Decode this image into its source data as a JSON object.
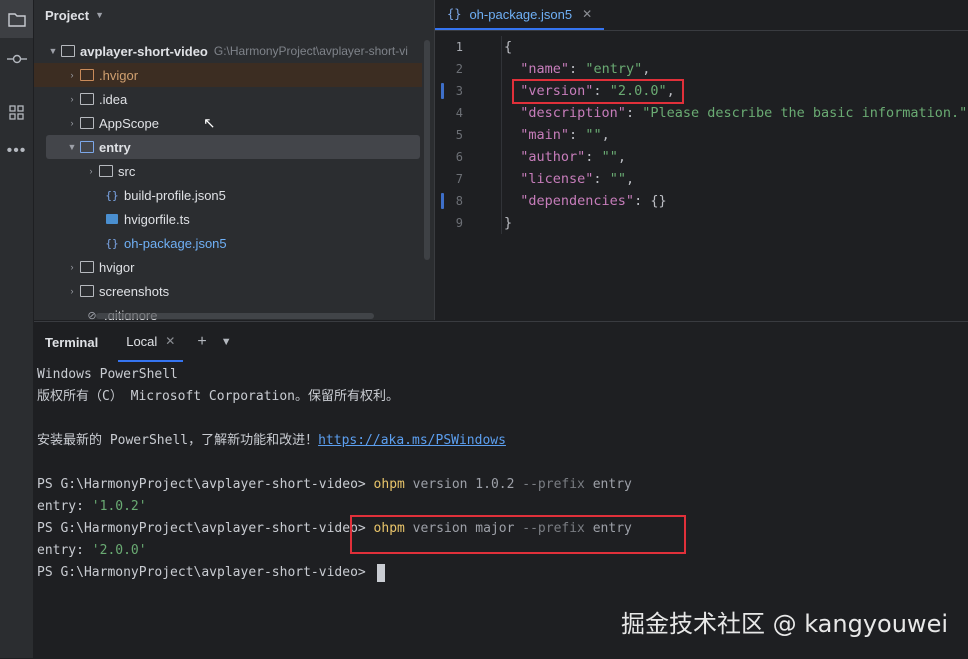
{
  "sidebar_tools": [
    "folder-icon",
    "commit-icon",
    "structure-icon",
    "more-icon"
  ],
  "project": {
    "title": "Project",
    "root": {
      "name": "avplayer-short-video",
      "path": "G:\\HarmonyProject\\avplayer-short-vi"
    },
    "items": [
      {
        "name": ".hvigor",
        "type": "folder"
      },
      {
        "name": ".idea",
        "type": "folder"
      },
      {
        "name": "AppScope",
        "type": "folder"
      },
      {
        "name": "entry",
        "type": "folder"
      },
      {
        "name": "src",
        "type": "folder"
      },
      {
        "name": "build-profile.json5",
        "type": "json"
      },
      {
        "name": "hvigorfile.ts",
        "type": "ts"
      },
      {
        "name": "oh-package.json5",
        "type": "json"
      },
      {
        "name": "hvigor",
        "type": "folder"
      },
      {
        "name": "screenshots",
        "type": "folder"
      },
      {
        "name": ".gitignore",
        "type": "ignore"
      }
    ]
  },
  "editor": {
    "tab": {
      "icon": "{}",
      "label": "oh-package.json5"
    },
    "line_numbers": [
      "1",
      "2",
      "3",
      "4",
      "5",
      "6",
      "7",
      "8",
      "9"
    ],
    "lines": [
      {
        "tokens": [
          [
            "p",
            "{"
          ]
        ]
      },
      {
        "tokens": [
          [
            "p",
            "  "
          ],
          [
            "k",
            "\"name\""
          ],
          [
            "p",
            ": "
          ],
          [
            "s",
            "\"entry\""
          ],
          [
            "p",
            ","
          ]
        ]
      },
      {
        "tokens": [
          [
            "p",
            "  "
          ],
          [
            "k",
            "\"version\""
          ],
          [
            "p",
            ": "
          ],
          [
            "s",
            "\"2.0.0\""
          ],
          [
            "p",
            ","
          ]
        ]
      },
      {
        "tokens": [
          [
            "p",
            "  "
          ],
          [
            "k",
            "\"description\""
          ],
          [
            "p",
            ": "
          ],
          [
            "s",
            "\"Please describe the basic information.\""
          ],
          [
            "p",
            ","
          ]
        ]
      },
      {
        "tokens": [
          [
            "p",
            "  "
          ],
          [
            "k",
            "\"main\""
          ],
          [
            "p",
            ": "
          ],
          [
            "s",
            "\"\""
          ],
          [
            "p",
            ","
          ]
        ]
      },
      {
        "tokens": [
          [
            "p",
            "  "
          ],
          [
            "k",
            "\"author\""
          ],
          [
            "p",
            ": "
          ],
          [
            "s",
            "\"\""
          ],
          [
            "p",
            ","
          ]
        ]
      },
      {
        "tokens": [
          [
            "p",
            "  "
          ],
          [
            "k",
            "\"license\""
          ],
          [
            "p",
            ": "
          ],
          [
            "s",
            "\"\""
          ],
          [
            "p",
            ","
          ]
        ]
      },
      {
        "tokens": [
          [
            "p",
            "  "
          ],
          [
            "k",
            "\"dependencies\""
          ],
          [
            "p",
            ": {}"
          ]
        ]
      },
      {
        "tokens": [
          [
            "p",
            "}"
          ]
        ]
      }
    ]
  },
  "terminal": {
    "title": "Terminal",
    "tab_label": "Local",
    "lines": [
      [
        [
          "t",
          "Windows PowerShell"
        ]
      ],
      [
        [
          "t",
          "版权所有（C） Microsoft Corporation。保留所有权利。"
        ]
      ],
      [
        [
          "t",
          ""
        ]
      ],
      [
        [
          "t",
          "安装最新的 PowerShell，了解新功能和改进！"
        ],
        [
          "a",
          "https://aka.ms/PSWindows"
        ]
      ],
      [
        [
          "t",
          ""
        ]
      ],
      [
        [
          "t",
          "PS G:\\HarmonyProject\\avplayer-short-video> "
        ],
        [
          "cmd",
          "ohpm"
        ],
        [
          "arg",
          " version 1.0.2 "
        ],
        [
          "flag",
          "--prefix"
        ],
        [
          "arg",
          " entry"
        ]
      ],
      [
        [
          "t",
          "entry: "
        ],
        [
          "str",
          "'1.0.2'"
        ]
      ],
      [
        [
          "t",
          "PS G:\\HarmonyProject\\avplayer-short-video> "
        ],
        [
          "cmd",
          "ohpm"
        ],
        [
          "arg",
          " version major "
        ],
        [
          "flag",
          "--prefix"
        ],
        [
          "arg",
          " entry"
        ]
      ],
      [
        [
          "t",
          "entry: "
        ],
        [
          "str",
          "'2.0.0'"
        ]
      ],
      [
        [
          "t",
          "PS G:\\HarmonyProject\\avplayer-short-video> "
        ],
        [
          "cursor",
          ""
        ]
      ]
    ]
  },
  "watermark": "掘金技术社区 @ kangyouwei",
  "colors": {
    "highlight_box": "#e0303a",
    "accent": "#3574f0",
    "string": "#6aab73",
    "key": "#c77dbb",
    "command": "#e8c46a"
  }
}
